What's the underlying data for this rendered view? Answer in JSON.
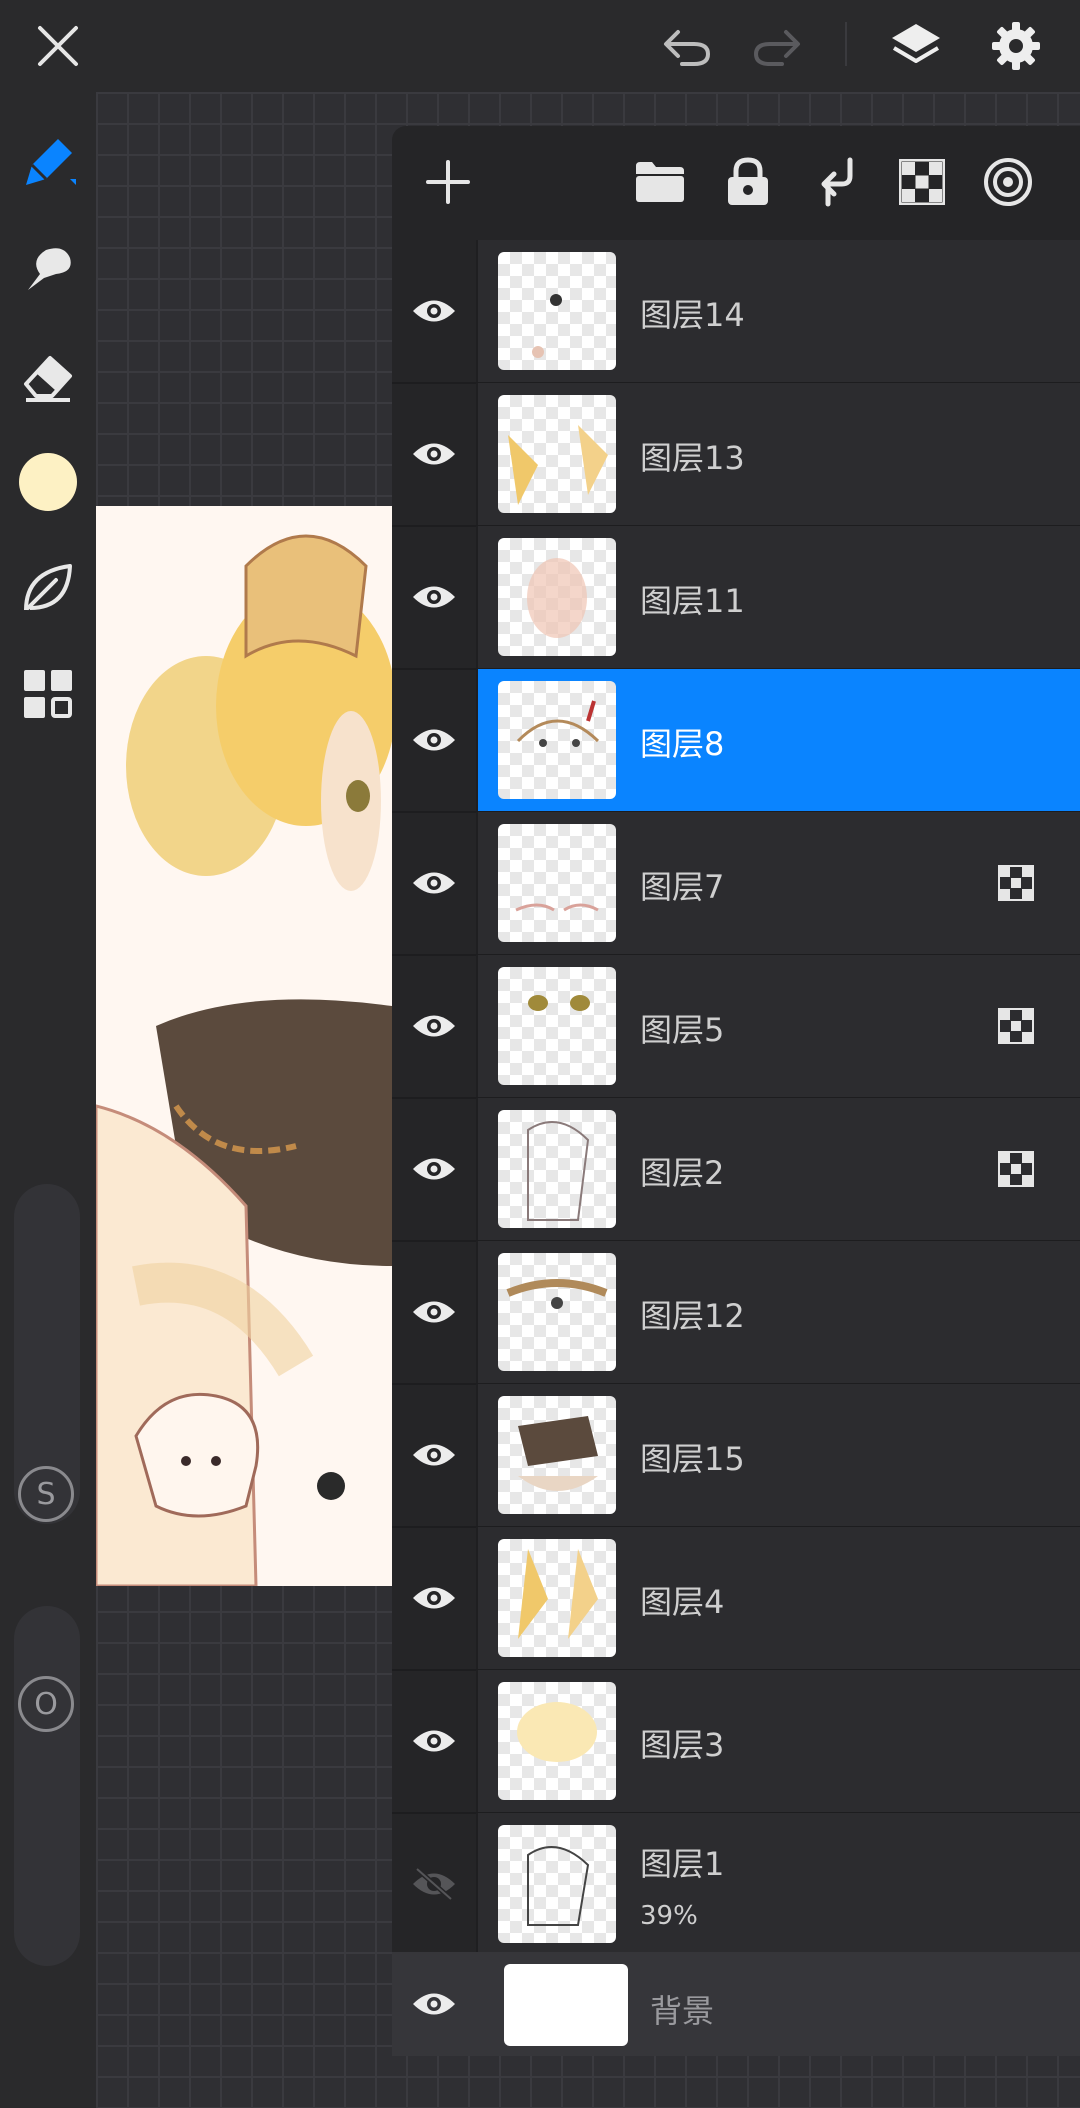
{
  "topbar": {
    "close_icon": "close-icon",
    "undo_icon": "undo-icon",
    "redo_icon": "redo-icon",
    "layers_icon": "layers-icon",
    "settings_icon": "gear-icon"
  },
  "toolbar": {
    "tools": [
      "brush-icon",
      "smudge-icon",
      "eraser-icon",
      "color-swatch",
      "leaf-icon",
      "grid-icon"
    ],
    "current_color": "#fdf1c4",
    "accent": "#0a84ff",
    "size_slider_label": "S",
    "opacity_slider_label": "O"
  },
  "layers_panel": {
    "header_icons": [
      "add-layer-icon",
      "folder-icon",
      "lock-icon",
      "merge-down-icon",
      "checker-icon",
      "target-icon"
    ],
    "layers": [
      {
        "name": "图层14",
        "visible": true,
        "selected": false,
        "mask": false
      },
      {
        "name": "图层13",
        "visible": true,
        "selected": false,
        "mask": false
      },
      {
        "name": "图层11",
        "visible": true,
        "selected": false,
        "mask": false
      },
      {
        "name": "图层8",
        "visible": true,
        "selected": true,
        "mask": false
      },
      {
        "name": "图层7",
        "visible": true,
        "selected": false,
        "mask": true
      },
      {
        "name": "图层5",
        "visible": true,
        "selected": false,
        "mask": true
      },
      {
        "name": "图层2",
        "visible": true,
        "selected": false,
        "mask": true
      },
      {
        "name": "图层12",
        "visible": true,
        "selected": false,
        "mask": false
      },
      {
        "name": "图层15",
        "visible": true,
        "selected": false,
        "mask": false
      },
      {
        "name": "图层4",
        "visible": true,
        "selected": false,
        "mask": false
      },
      {
        "name": "图层3",
        "visible": true,
        "selected": false,
        "mask": false
      },
      {
        "name": "图层1",
        "visible": false,
        "selected": false,
        "mask": false,
        "opacity": "39%"
      }
    ],
    "background": {
      "name": "背景",
      "visible": true
    }
  }
}
